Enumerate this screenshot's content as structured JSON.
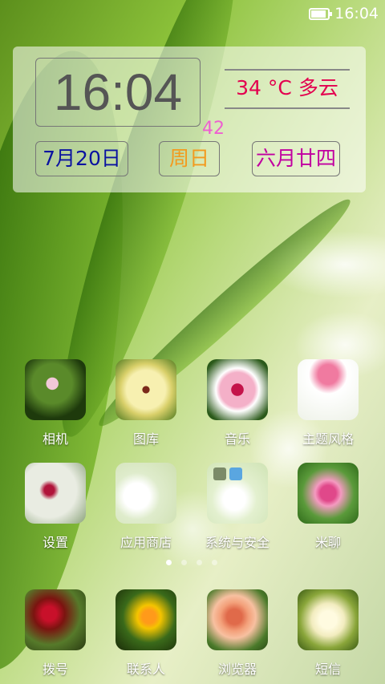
{
  "status_bar": {
    "time": "16:04",
    "battery_level": 0.8
  },
  "widget": {
    "clock": "16:04",
    "weather": "34 °C 多云",
    "aux_number": "42",
    "date": "7月20日",
    "weekday": "周日",
    "lunar_date": "六月廿四"
  },
  "apps_row1": [
    {
      "label": "相机",
      "icon": "camera-flower-icon"
    },
    {
      "label": "图库",
      "icon": "gallery-flower-icon"
    },
    {
      "label": "音乐",
      "icon": "music-flower-icon"
    },
    {
      "label": "主题风格",
      "icon": "theme-flower-icon"
    }
  ],
  "apps_row2": [
    {
      "label": "设置",
      "icon": "settings-flower-icon"
    },
    {
      "label": "应用商店",
      "icon": "app-store-flower-icon"
    },
    {
      "label": "系统与安全",
      "icon": "system-security-folder-icon"
    },
    {
      "label": "米聊",
      "icon": "miliao-flower-icon"
    }
  ],
  "page_indicator": {
    "count": 4,
    "active": 0
  },
  "dock": [
    {
      "label": "拨号",
      "icon": "dialer-flower-icon"
    },
    {
      "label": "联系人",
      "icon": "contacts-flower-icon"
    },
    {
      "label": "浏览器",
      "icon": "browser-flower-icon"
    },
    {
      "label": "短信",
      "icon": "messages-flower-icon"
    }
  ]
}
